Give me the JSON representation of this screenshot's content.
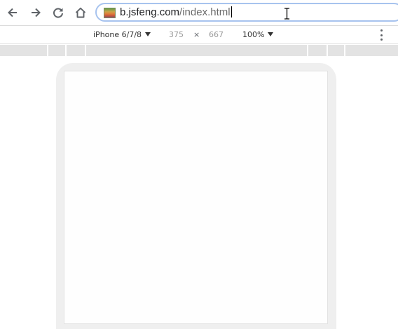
{
  "browser": {
    "back_icon": "arrow-left-icon",
    "forward_icon": "arrow-right-icon",
    "reload_icon": "reload-icon",
    "home_icon": "home-icon",
    "url_domain": "b.jsfeng.com",
    "url_path": "/index.html"
  },
  "device_toolbar": {
    "device_name": "iPhone 6/7/8",
    "width": "375",
    "times": "×",
    "height": "667",
    "zoom": "100%",
    "more_icon": "more-vert-icon"
  }
}
